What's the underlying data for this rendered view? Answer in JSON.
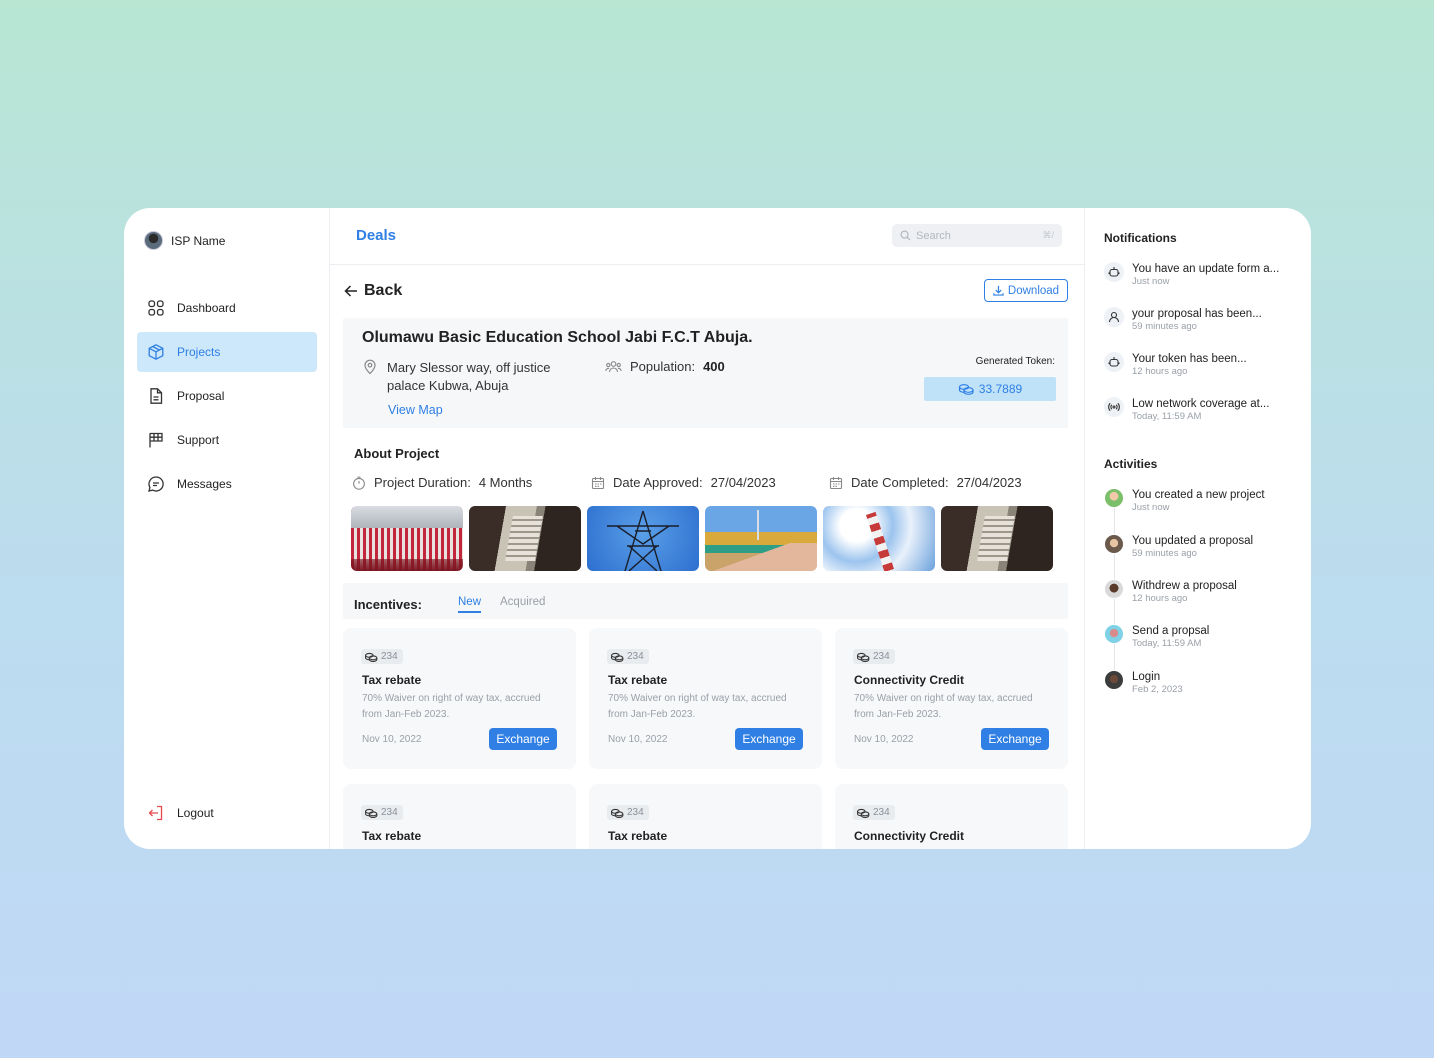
{
  "sidebar": {
    "profile_name": "ISP Name",
    "items": [
      {
        "label": "Dashboard",
        "icon": "dashboard-icon"
      },
      {
        "label": "Projects",
        "icon": "box-icon"
      },
      {
        "label": "Proposal",
        "icon": "document-icon"
      },
      {
        "label": "Support",
        "icon": "flag-icon"
      },
      {
        "label": "Messages",
        "icon": "chat-icon"
      }
    ],
    "active_item": "Projects",
    "logout_label": "Logout"
  },
  "header": {
    "title": "Deals",
    "search_placeholder": "Search",
    "search_shortcut": "⌘/"
  },
  "main": {
    "back_label": "Back",
    "download_label": "Download",
    "project": {
      "name": "Olumawu Basic Education School Jabi F.C.T Abuja.",
      "address_line1": "Mary Slessor way, off justice",
      "address_line2": "palace Kubwa, Abuja",
      "view_map": "View Map",
      "population_label": "Population:",
      "population_value": "400",
      "generated_token_label": "Generated Token:",
      "generated_token_value": "33.7889"
    },
    "about": {
      "title": "About Project",
      "duration_label": "Project Duration:",
      "duration_value": "4 Months",
      "approved_label": "Date Approved:",
      "approved_value": "27/04/2023",
      "completed_label": "Date Completed:",
      "completed_value": "27/04/2023"
    },
    "incentives": {
      "label": "Incentives:",
      "tabs": [
        "New",
        "Acquired"
      ],
      "active_tab": "New",
      "cards": [
        {
          "amount": "234",
          "title": "Tax rebate",
          "desc": "70% Waiver on right of way tax, accrued from Jan-Feb 2023.",
          "date": "Nov 10, 2022",
          "action": "Exchange"
        },
        {
          "amount": "234",
          "title": "Tax rebate",
          "desc": "70% Waiver on right of way tax, accrued from Jan-Feb 2023.",
          "date": "Nov 10, 2022",
          "action": "Exchange"
        },
        {
          "amount": "234",
          "title": "Connectivity Credit",
          "desc": "70% Waiver on right of way tax, accrued from Jan-Feb 2023.",
          "date": "Nov 10, 2022",
          "action": "Exchange"
        },
        {
          "amount": "234",
          "title": "Tax rebate"
        },
        {
          "amount": "234",
          "title": "Tax rebate"
        },
        {
          "amount": "234",
          "title": "Connectivity Credit"
        }
      ]
    }
  },
  "notifications": {
    "title": "Notifications",
    "items": [
      {
        "text": "You have an update form a...",
        "time": "Just now",
        "icon": "robot-icon"
      },
      {
        "text": "your proposal has been...",
        "time": "59 minutes ago",
        "icon": "user-icon"
      },
      {
        "text": "Your token has been...",
        "time": "12 hours ago",
        "icon": "robot-icon"
      },
      {
        "text": "Low network coverage at...",
        "time": "Today, 11:59 AM",
        "icon": "signal-icon"
      }
    ]
  },
  "activities": {
    "title": "Activities",
    "items": [
      {
        "text": "You created a new project",
        "time": "Just now"
      },
      {
        "text": "You updated a proposal",
        "time": "59 minutes ago"
      },
      {
        "text": "Withdrew a proposal",
        "time": "12 hours ago"
      },
      {
        "text": "Send a propsal",
        "time": "Today, 11:59 AM"
      },
      {
        "text": "Login",
        "time": "Feb 2, 2023"
      }
    ]
  },
  "colors": {
    "accent": "#2f7fe4",
    "active_bg": "#cce8fa",
    "token_bg": "#bfe2f8",
    "logout_icon": "#e5484d"
  }
}
